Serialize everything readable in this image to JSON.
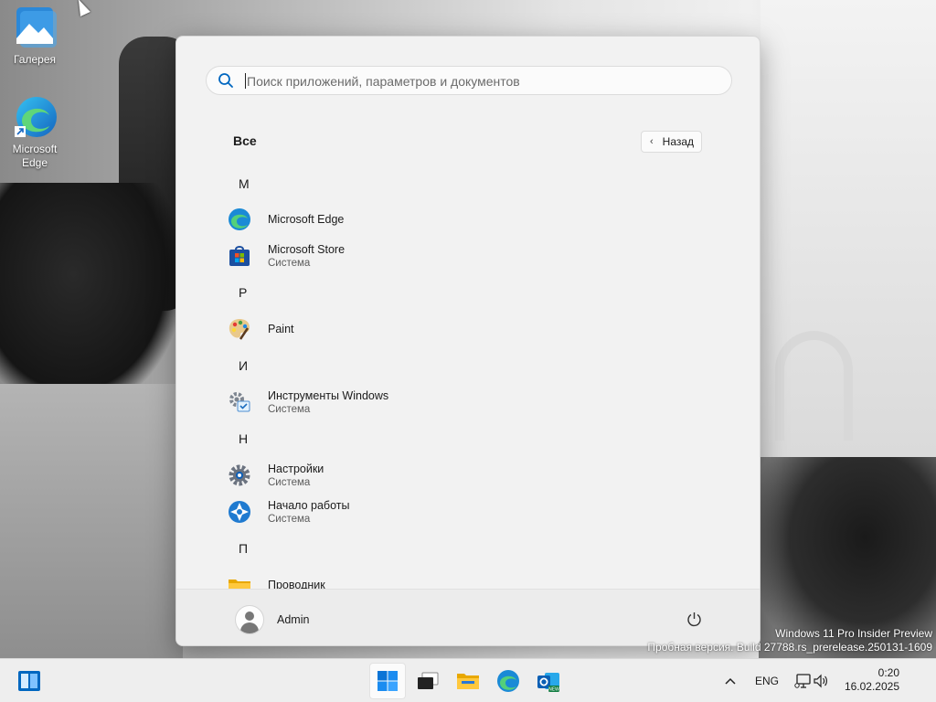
{
  "desktop": {
    "icons": [
      {
        "label": "Галерея"
      },
      {
        "label": "Microsoft\nEdge"
      }
    ]
  },
  "start_menu": {
    "search": {
      "placeholder": "Поиск приложений, параметров и документов",
      "value": ""
    },
    "section_title": "Все",
    "back_label": "Назад",
    "groups": [
      {
        "letter": "M"
      },
      {
        "letter": "P"
      },
      {
        "letter": "И"
      },
      {
        "letter": "Н"
      },
      {
        "letter": "П"
      }
    ],
    "apps": [
      {
        "name": "Microsoft Edge",
        "sub": "",
        "icon": "edge-icon"
      },
      {
        "name": "Microsoft Store",
        "sub": "Система",
        "icon": "store-icon"
      },
      {
        "name": "Paint",
        "sub": "",
        "icon": "paint-icon"
      },
      {
        "name": "Инструменты Windows",
        "sub": "Система",
        "icon": "windows-tools-icon"
      },
      {
        "name": "Настройки",
        "sub": "Система",
        "icon": "settings-icon"
      },
      {
        "name": "Начало работы",
        "sub": "Система",
        "icon": "get-started-icon"
      },
      {
        "name": "Проводник",
        "sub": "",
        "icon": "folder-icon"
      }
    ],
    "user": {
      "name": "Admin"
    }
  },
  "watermark": {
    "line1": "Windows 11 Pro Insider Preview",
    "line2": "Пробная версия. Build 27788.rs_prerelease.250131-1609"
  },
  "taskbar": {
    "language": "ENG",
    "time": "0:20",
    "date": "16.02.2025"
  },
  "colors": {
    "accent": "#0067c0",
    "menu_bg": "#f2f2f2",
    "taskbar_bg": "#eeeeee"
  }
}
